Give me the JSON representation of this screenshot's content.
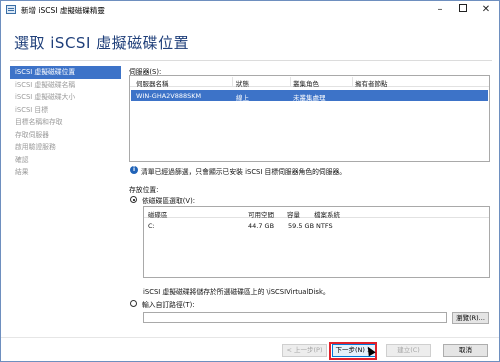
{
  "window": {
    "title": "新增 iSCSI 虛擬磁碟精靈"
  },
  "page_title": "選取 iSCSI 虛擬磁碟位置",
  "nav": [
    {
      "label": "iSCSI 虛擬磁碟位置",
      "active": true
    },
    {
      "label": "iSCSI 虛擬磁碟名稱"
    },
    {
      "label": "iSCSI 虛擬磁碟大小"
    },
    {
      "label": "iSCSI 目標"
    },
    {
      "label": "目標名稱和存取"
    },
    {
      "label": "存取伺服器"
    },
    {
      "label": "啟用驗證服務"
    },
    {
      "label": "確認"
    },
    {
      "label": "結果"
    }
  ],
  "server_section": {
    "label": "伺服器(S):",
    "columns": [
      "伺服器名稱",
      "狀態",
      "叢集角色",
      "擁有者節點"
    ],
    "rows": [
      {
        "name": "WIN-GHA2V888SKM",
        "status": "線上",
        "role": "未叢集處理",
        "owner": ""
      }
    ]
  },
  "info_text": "清單已經過篩選，只會顯示已安裝 iSCSI 目標伺服器角色的伺服器。",
  "storage": {
    "label": "存放位置:",
    "by_volume_label": "依磁碟區選取(V):",
    "volume_columns": [
      "磁碟區",
      "可用空間",
      "容量",
      "檔案系統"
    ],
    "volumes": [
      {
        "volume": "C:",
        "free": "44.7 GB",
        "capacity": "59.5 GB",
        "fs": "NTFS"
      }
    ],
    "volume_note": "iSCSI 虛擬磁碟將儲存於所選磁碟區上的 \\iSCSIVirtualDisk。",
    "custom_path_label": "輸入自訂路徑(T):",
    "custom_path_value": "",
    "browse_label": "瀏覽(R)..."
  },
  "footer": {
    "prev_label": "< 上一步(P)",
    "next_label": "下一步(N) >",
    "create_label": "建立(C)",
    "cancel_label": "取消"
  },
  "accent_color": "#3d73c8",
  "title_color": "#1f3f7a"
}
